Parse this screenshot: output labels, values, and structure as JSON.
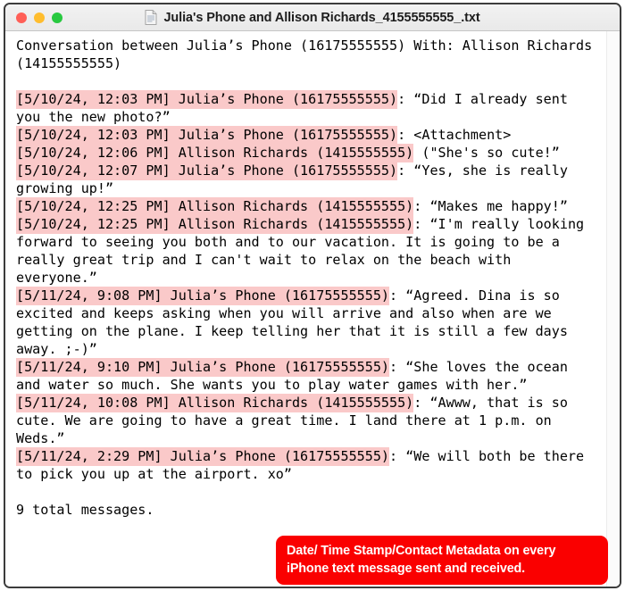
{
  "window": {
    "title": "Julia's Phone and Allison Richards_4155555555_.txt",
    "file_icon": "text-document-icon",
    "traffic_lights": [
      {
        "name": "close-button",
        "color": "#ff5f57"
      },
      {
        "name": "minimize-button",
        "color": "#ffbd2e"
      },
      {
        "name": "maximize-button",
        "color": "#28c940"
      }
    ]
  },
  "document": {
    "header": "Conversation between Julia’s Phone (16175555555) With: Allison Richards (14155555555)",
    "highlight_color": "#fac9c9",
    "messages": [
      {
        "meta": "[5/10/24, 12:03 PM] Julia’s Phone (16175555555)",
        "body": ": “Did I already sent you the new photo?”"
      },
      {
        "meta": "[5/10/24, 12:03 PM] Julia’s Phone (16175555555)",
        "body": ": <Attachment>"
      },
      {
        "meta": "[5/10/24, 12:06 PM] Allison Richards (1415555555)",
        "body": " (\"She's so cute!”"
      },
      {
        "meta": "[5/10/24, 12:07 PM] Julia’s Phone (16175555555)",
        "body": ": “Yes, she is really growing up!”"
      },
      {
        "meta": "[5/10/24, 12:25 PM] Allison Richards (1415555555)",
        "body": ": “Makes me happy!”"
      },
      {
        "meta": "[5/10/24, 12:25 PM] Allison Richards (1415555555)",
        "body": ": “I'm really looking forward to seeing you both and to our vacation. It is going to be a really great trip and I can't wait to relax on the beach with everyone.”"
      },
      {
        "meta": "[5/11/24, 9:08 PM] Julia’s Phone (16175555555)",
        "body": ": “Agreed. Dina is so excited and keeps asking when you will arrive and also when are we getting on the plane. I keep telling her that it is still a few days away. ;-)”"
      },
      {
        "meta": "[5/11/24, 9:10 PM] Julia’s Phone (16175555555)",
        "body": ": “She loves the ocean and water so much. She wants you to play water games with her.”"
      },
      {
        "meta": "[5/11/24, 10:08 PM] Allison Richards (1415555555)",
        "body": ": “Awww, that is so cute. We are going to have a great time. I land there at 1 p.m. on Weds.”"
      },
      {
        "meta": "[5/11/24, 2:29 PM] Julia’s Phone (16175555555)",
        "body": ": “We will both be there to pick you up at the airport. xo”"
      }
    ],
    "footer": "9 total messages."
  },
  "callout": {
    "background": "#fa0000",
    "text_color": "#ffffff",
    "line1": "Date/ Time Stamp/Contact Metadata on every",
    "line2": "iPhone text message sent and received."
  }
}
